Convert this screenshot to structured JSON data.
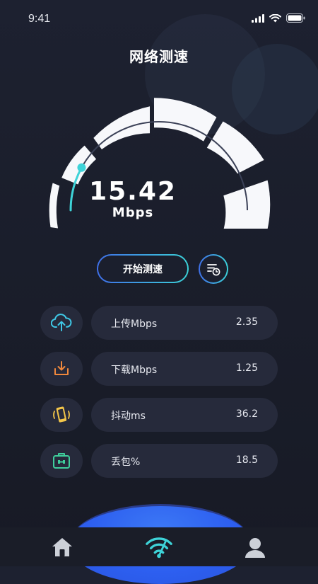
{
  "status_bar": {
    "time": "9:41"
  },
  "header": {
    "title": "网络测速"
  },
  "gauge": {
    "value": "15.42",
    "unit": "Mbps",
    "level": 0.16
  },
  "actions": {
    "start_label": "开始测速"
  },
  "metrics": [
    {
      "label": "上传Mbps",
      "value": "2.35",
      "icon": "upload-cloud-icon",
      "color": "#3fc8e6"
    },
    {
      "label": "下载Mbps",
      "value": "1.25",
      "icon": "download-icon",
      "color": "#f0883c"
    },
    {
      "label": "抖动ms",
      "value": "36.2",
      "icon": "vibrating-phone-icon",
      "color": "#f3c64a"
    },
    {
      "label": "丢包%",
      "value": "18.5",
      "icon": "packet-box-icon",
      "color": "#3fcf9c"
    }
  ],
  "tabs": [
    {
      "name": "home",
      "icon": "home-icon"
    },
    {
      "name": "speed-test",
      "icon": "wifi-speed-icon",
      "active": true
    },
    {
      "name": "profile",
      "icon": "user-icon"
    }
  ],
  "colors": {
    "accent_teal": "#3ed3d8",
    "accent_blue": "#3f6fe8",
    "glow_blue": "#2d5ff0"
  }
}
